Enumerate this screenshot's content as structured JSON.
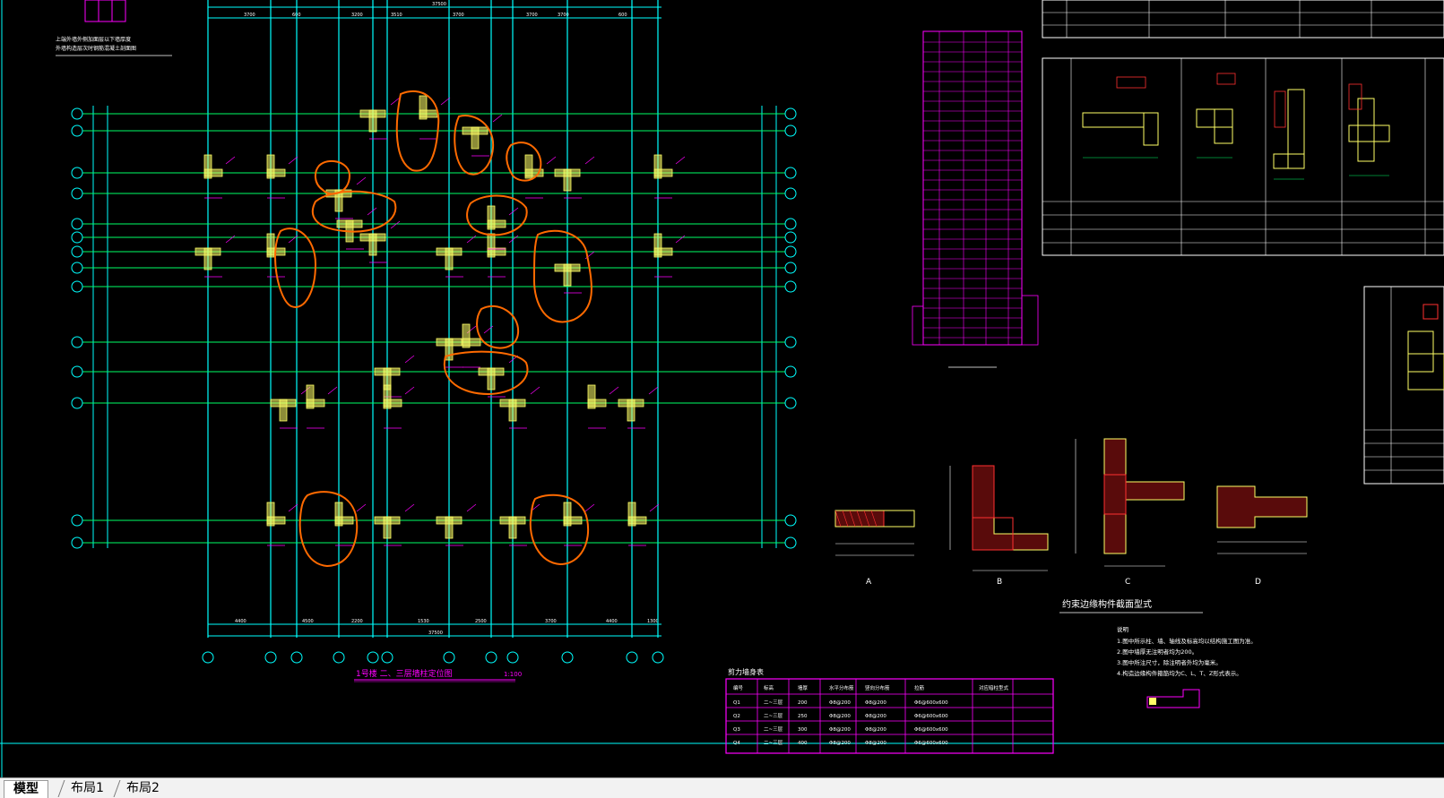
{
  "tabs": [
    {
      "label": "模型",
      "active": true
    },
    {
      "label": "布局1",
      "active": false
    },
    {
      "label": "布局2",
      "active": false
    }
  ],
  "drawing": {
    "plan_title": "1号楼  二、三层墙柱定位图",
    "plan_scale": "1:100",
    "top_note_line1": "上端外墙外侧加面层以下墙厚度",
    "top_note_line2": "外墙构造层次时钢筋混凝土剖面图",
    "wall_table": {
      "title": "剪力墙身表",
      "headers": [
        "编号",
        "标高",
        "墙厚",
        "水平分布筋",
        "竖向分布筋",
        "拉筋",
        "对应暗柱型式"
      ],
      "rows": [
        [
          "Q1",
          "二~三层",
          "200",
          "Φ8@200",
          "Φ8@200",
          "Φ6@600x600",
          ""
        ],
        [
          "Q2",
          "二~三层",
          "250",
          "Φ8@200",
          "Φ8@200",
          "Φ6@600x600",
          ""
        ],
        [
          "Q3",
          "二~三层",
          "300",
          "Φ8@200",
          "Φ8@200",
          "Φ6@600x600",
          ""
        ],
        [
          "Q4",
          "二~三层",
          "400",
          "Φ8@200",
          "Φ8@200",
          "Φ6@600x600",
          ""
        ]
      ]
    },
    "section_labels": [
      "A",
      "B",
      "C",
      "D"
    ],
    "section_caption": "约束边缘构件截面型式",
    "notes_title": "说明",
    "notes": [
      "1.图中所示柱、墙、轴线及标高均以结构施工图为准。",
      "2.图中墙厚无注明者均为200。",
      "3.图中所注尺寸，除注明者外均为毫米。",
      "4.构造边缘构件箍筋均为C、L、T、Z形式表示。"
    ],
    "colors": {
      "background": "#000000",
      "grid_cyan": "#00ffff",
      "grid_green": "#00ff00",
      "walls_yellow": "#ffff66",
      "magenta": "#ff00ff",
      "markup_orange": "#ff6a00",
      "white": "#ffffff",
      "red": "#ff3030"
    }
  }
}
